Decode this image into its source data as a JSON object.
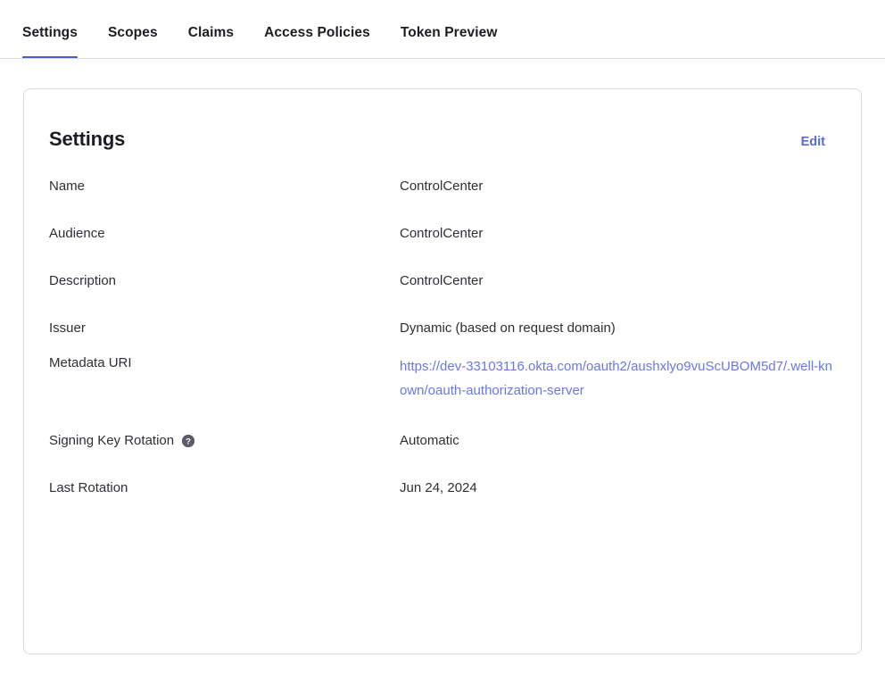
{
  "tabs": [
    {
      "label": "Settings",
      "active": true
    },
    {
      "label": "Scopes",
      "active": false
    },
    {
      "label": "Claims",
      "active": false
    },
    {
      "label": "Access Policies",
      "active": false
    },
    {
      "label": "Token Preview",
      "active": false
    }
  ],
  "card": {
    "title": "Settings",
    "edit_label": "Edit",
    "fields": [
      {
        "label": "Name",
        "value": "ControlCenter"
      },
      {
        "label": "Audience",
        "value": "ControlCenter"
      },
      {
        "label": "Description",
        "value": "ControlCenter"
      },
      {
        "label": "Issuer",
        "value": "Dynamic (based on request domain)"
      },
      {
        "label": "Metadata URI",
        "value": "https://dev-33103116.okta.com/oauth2/aushxlyo9vuScUBOM5d7/.well-known/oauth-authorization-server"
      },
      {
        "label": "Signing Key Rotation",
        "value": "Automatic",
        "help_icon": "help-circle-icon"
      },
      {
        "label": "Last Rotation",
        "value": "Jun 24, 2024"
      }
    ]
  },
  "colors": {
    "accent": "#4f5ed7",
    "link": "#6b76e8",
    "edit_link": "#5a6ae0",
    "text": "#2f2f35",
    "heading": "#1d1d21",
    "border": "#dcdcdc",
    "divider": "#d8d8d8",
    "help_icon_bg": "#5c5c66"
  }
}
